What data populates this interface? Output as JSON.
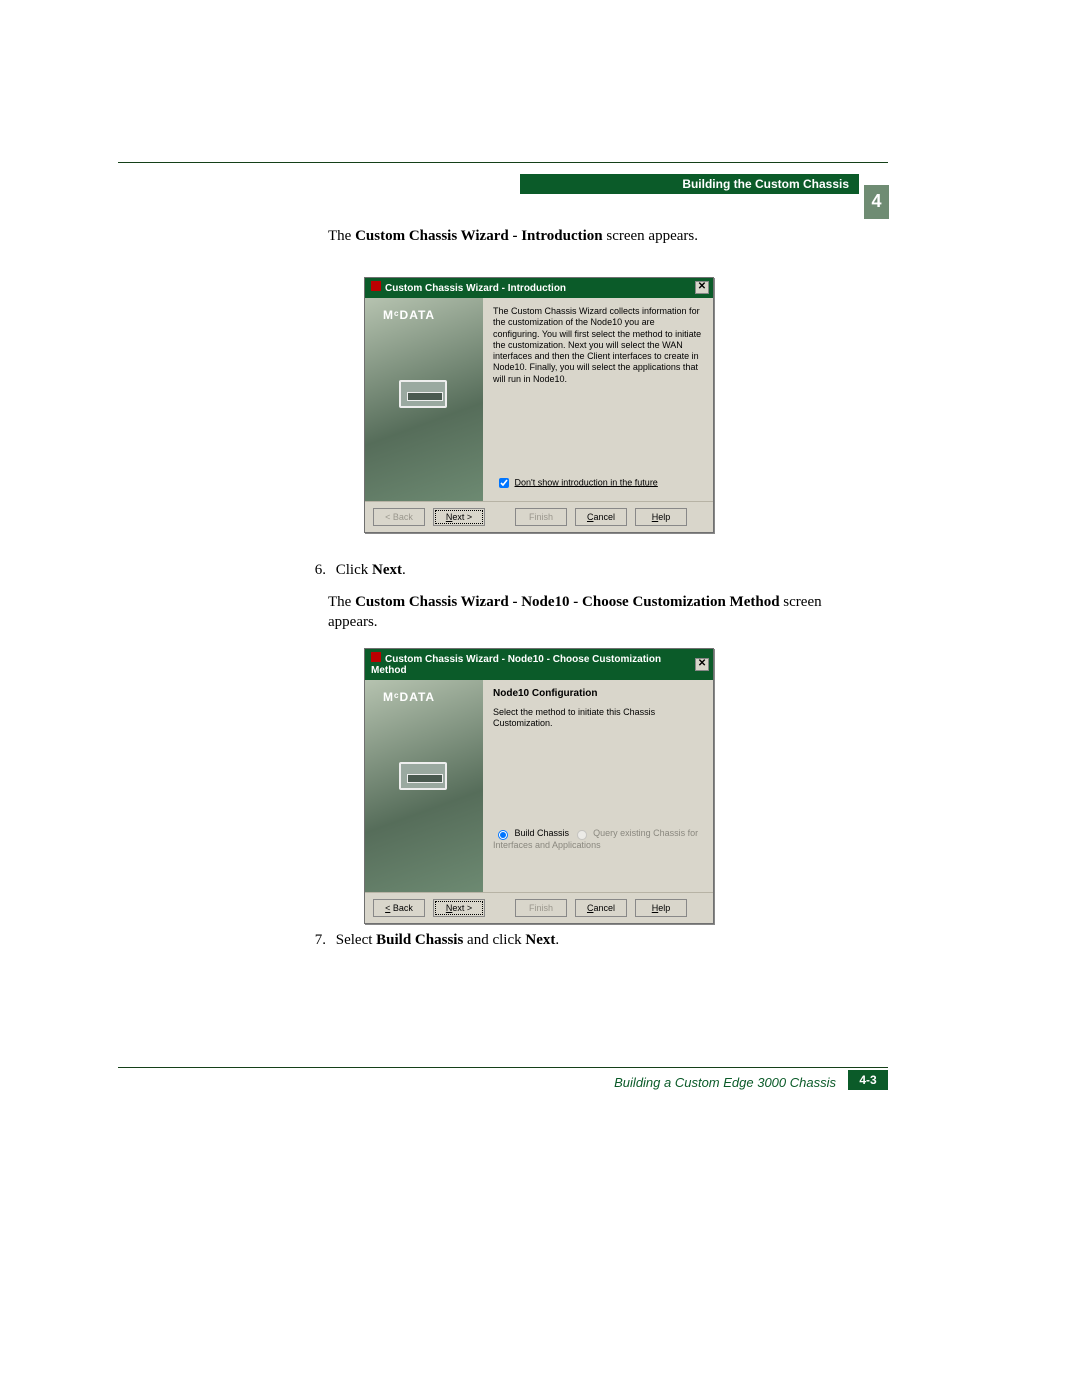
{
  "header": {
    "section": "Building the Custom Chassis",
    "chapter": "4"
  },
  "intro1": {
    "pre": "The ",
    "bold": "Custom Chassis Wizard - Introduction",
    "post": " screen appears."
  },
  "step6": {
    "num": "6.",
    "pre": "Click ",
    "bold": "Next",
    "post": "."
  },
  "intro2": {
    "pre": "The ",
    "bold": "Custom Chassis Wizard - Node10 - Choose Customization Method",
    "post": " screen appears."
  },
  "step7": {
    "num": "7.",
    "pre": "Select ",
    "bold1": "Build Chassis",
    "mid": " and click ",
    "bold2": "Next",
    "post": "."
  },
  "footer": {
    "title": "Building a Custom Edge 3000 Chassis",
    "page": "4-3"
  },
  "dlg1": {
    "title": "Custom Chassis Wizard - Introduction",
    "brand": "MᶜDATA",
    "text": "The Custom Chassis Wizard collects information for the customization of the Node10 you are configuring. You will first select the method to initiate the customization. Next you will select the WAN interfaces and then the Client interfaces to create in Node10.  Finally, you will select the applications that will run in Node10.",
    "checkbox": "Don't show introduction in the future",
    "buttons": {
      "back": "< Back",
      "next": "Next >",
      "finish": "Finish",
      "cancel": "Cancel",
      "help": "Help"
    }
  },
  "dlg2": {
    "title": "Custom Chassis Wizard - Node10 - Choose Customization Method",
    "brand": "MᶜDATA",
    "heading": "Node10 Configuration",
    "sub": "Select the method to initiate this Chassis Customization.",
    "radio1": "Build Chassis",
    "radio2": "Query existing Chassis for Interfaces and Applications",
    "buttons": {
      "back": "< Back",
      "next": "Next >",
      "finish": "Finish",
      "cancel": "Cancel",
      "help": "Help"
    }
  }
}
